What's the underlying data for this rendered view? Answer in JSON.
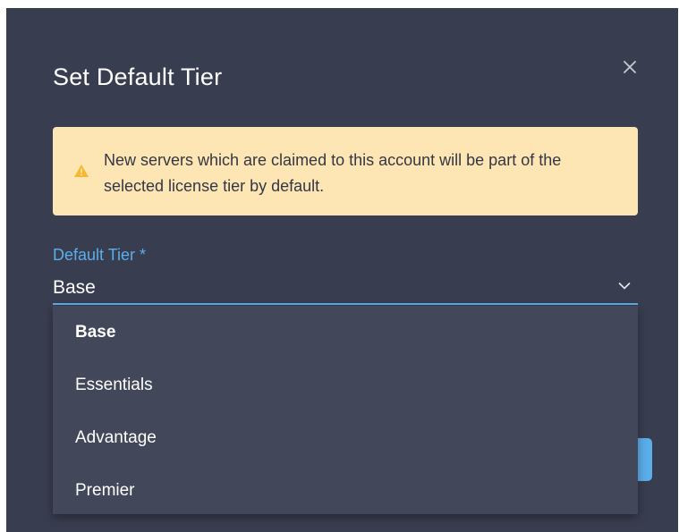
{
  "dialog": {
    "title": "Set Default Tier",
    "close_icon": "close-icon"
  },
  "alert": {
    "icon": "warning-icon",
    "text": "New servers which are claimed to this account will be part of the selected license tier by default."
  },
  "field": {
    "label": "Default Tier *",
    "value": "Base",
    "chevron_icon": "chevron-down-icon"
  },
  "dropdown": {
    "options": [
      {
        "label": "Base",
        "selected": true
      },
      {
        "label": "Essentials",
        "selected": false
      },
      {
        "label": "Advantage",
        "selected": false
      },
      {
        "label": "Premier",
        "selected": false
      }
    ]
  },
  "colors": {
    "modal_bg": "#393d50",
    "accent": "#5aaeea",
    "alert_bg": "#fde6b4",
    "warning": "#f5b82e",
    "dropdown_bg": "#42475a"
  }
}
